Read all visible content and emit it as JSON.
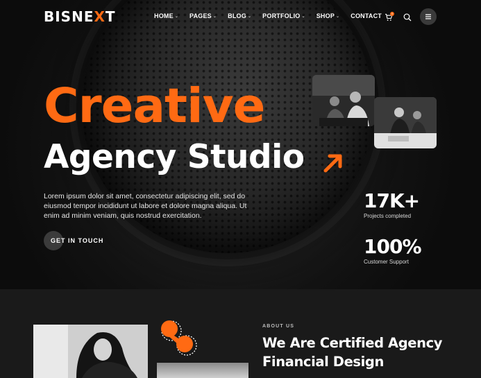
{
  "header": {
    "logo_left": "BISNE",
    "logo_x": "X",
    "logo_right": "T",
    "nav": [
      {
        "label": "HOME",
        "has_dropdown": true
      },
      {
        "label": "PAGES",
        "has_dropdown": true
      },
      {
        "label": "BLOG",
        "has_dropdown": true
      },
      {
        "label": "PORTFOLIO",
        "has_dropdown": true
      },
      {
        "label": "SHOP",
        "has_dropdown": true
      },
      {
        "label": "CONTACT",
        "has_dropdown": false
      }
    ],
    "dropdown_glyph": "⌄",
    "cart_count": "0",
    "icons": [
      "cart-icon",
      "search-icon",
      "menu-icon"
    ]
  },
  "hero": {
    "title_line1": "Creative",
    "title_line2": "Agency Studio",
    "description": "Lorem ipsum dolor sit amet, consectetur adipiscing elit, sed do eiusmod tempor incididunt ut labore et dolore magna aliqua. Ut enim ad minim veniam, quis nostrud exercitation.",
    "cta_label": "GET IN TOUCH",
    "stats": [
      {
        "value": "17K+",
        "label": "Projects completed"
      },
      {
        "value": "100%",
        "label": "Customer Support"
      }
    ]
  },
  "about": {
    "eyebrow": "ABOUT US",
    "title": "We Are Certified Agency Financial Design"
  },
  "colors": {
    "accent": "#ff6a13",
    "background": "#141414",
    "section_bg": "#1a1a1a"
  }
}
